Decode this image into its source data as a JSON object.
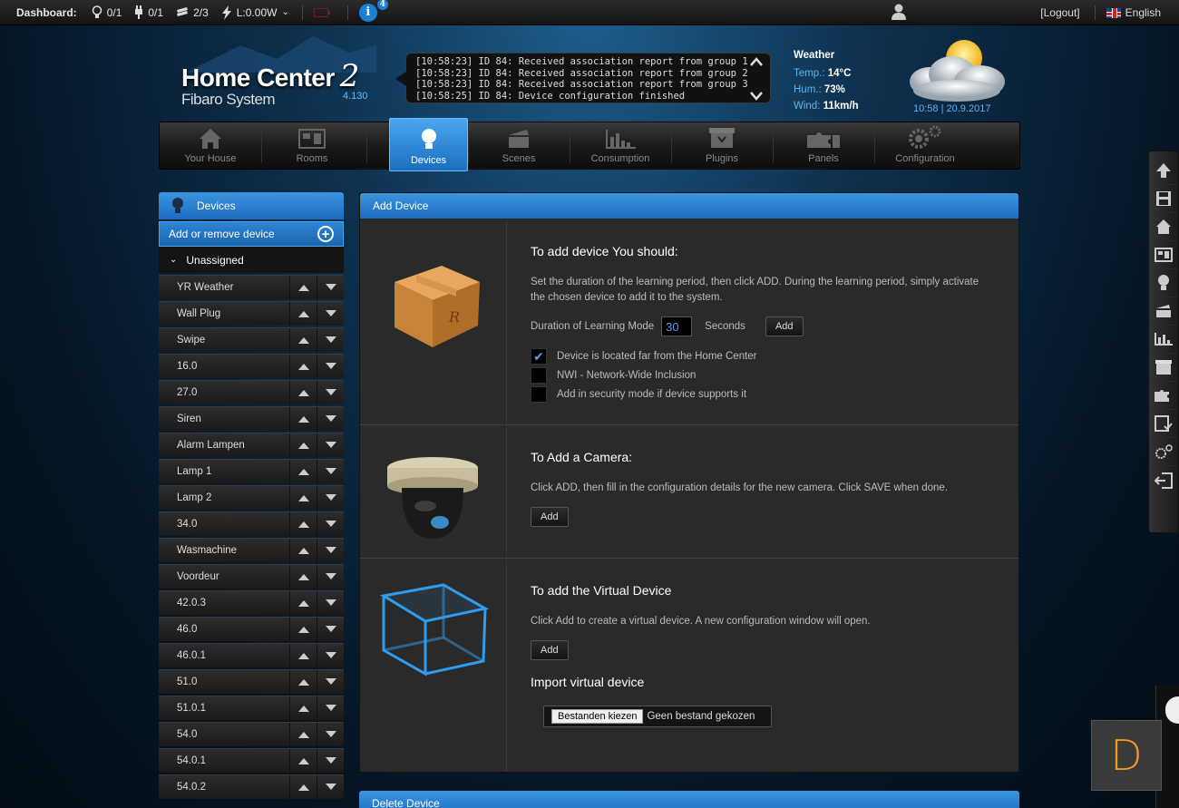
{
  "topbar": {
    "dashboard_label": "Dashboard:",
    "lights": "0/1",
    "plugs": "0/1",
    "blinds": "2/3",
    "power": "L:0.00W",
    "info_count": "4",
    "logout": "[Logout]",
    "language": "English"
  },
  "header": {
    "logo_title": "Home Center",
    "logo_number": "2",
    "logo_sub": "Fibaro System",
    "version": "4.130",
    "log_lines": [
      "[10:58:23] ID 84: Received association report from group 1",
      "[10:58:23] ID 84: Received association report from group 2",
      "[10:58:23] ID 84: Received association report from group 3",
      "[10:58:25] ID 84: Device configuration finished"
    ],
    "weather": {
      "title": "Weather",
      "temp_label": "Temp.:",
      "temp_value": "14°C",
      "hum_label": "Hum.:",
      "hum_value": "73%",
      "wind_label": "Wind:",
      "wind_value": "11km/h",
      "time": "10:58 | 20.9.2017"
    }
  },
  "nav": {
    "tabs": [
      {
        "label": "Your House",
        "icon": "house-icon"
      },
      {
        "label": "Rooms",
        "icon": "rooms-icon"
      },
      {
        "label": "Devices",
        "icon": "bulb-icon",
        "active": true
      },
      {
        "label": "Scenes",
        "icon": "clapper-icon"
      },
      {
        "label": "Consumption",
        "icon": "chart-icon"
      },
      {
        "label": "Plugins",
        "icon": "box-icon"
      },
      {
        "label": "Panels",
        "icon": "puzzle-icon"
      },
      {
        "label": "Configuration",
        "icon": "gears-icon"
      }
    ]
  },
  "sidebar": {
    "title": "Devices",
    "add_remove": "Add or remove device",
    "group": "Unassigned",
    "devices": [
      "YR Weather",
      "Wall Plug",
      "Swipe",
      "16.0",
      "27.0",
      "Siren",
      "Alarm Lampen",
      "Lamp 1",
      "Lamp 2",
      "34.0",
      "Wasmachine",
      "Voordeur",
      "42.0.3",
      "46.0",
      "46.0.1",
      "51.0",
      "51.0.1",
      "54.0",
      "54.0.1",
      "54.0.2"
    ]
  },
  "panel": {
    "title": "Add Device",
    "add_device": {
      "heading": "To add device You should:",
      "text": "Set the duration of the learning period, then click ADD. During the learning period, simply activate the chosen device to add it to the system.",
      "duration_label": "Duration of Learning Mode",
      "duration_value": "30",
      "seconds_label": "Seconds",
      "add_label": "Add",
      "options": [
        {
          "label": "Device is located far from the Home Center",
          "checked": true
        },
        {
          "label": "NWI - Network-Wide Inclusion",
          "checked": false
        },
        {
          "label": "Add in security mode if device supports it",
          "checked": false
        }
      ]
    },
    "camera": {
      "heading": "To Add a Camera:",
      "text": "Click ADD, then fill in the configuration details for the new camera. Click SAVE when done.",
      "add_label": "Add"
    },
    "virtual": {
      "heading": "To add the Virtual Device",
      "text": "Click Add to create a virtual device. A new configuration window will open.",
      "add_label": "Add",
      "import_heading": "Import virtual device",
      "file_button": "Bestanden kiezen",
      "file_status": "Geen bestand gekozen"
    }
  },
  "delete_panel": {
    "title": "Delete Device"
  },
  "badge_letter": "D",
  "colors": {
    "accent": "#1c6cbf",
    "highlight": "#4aa3ee",
    "badge": "#f39a1a"
  }
}
